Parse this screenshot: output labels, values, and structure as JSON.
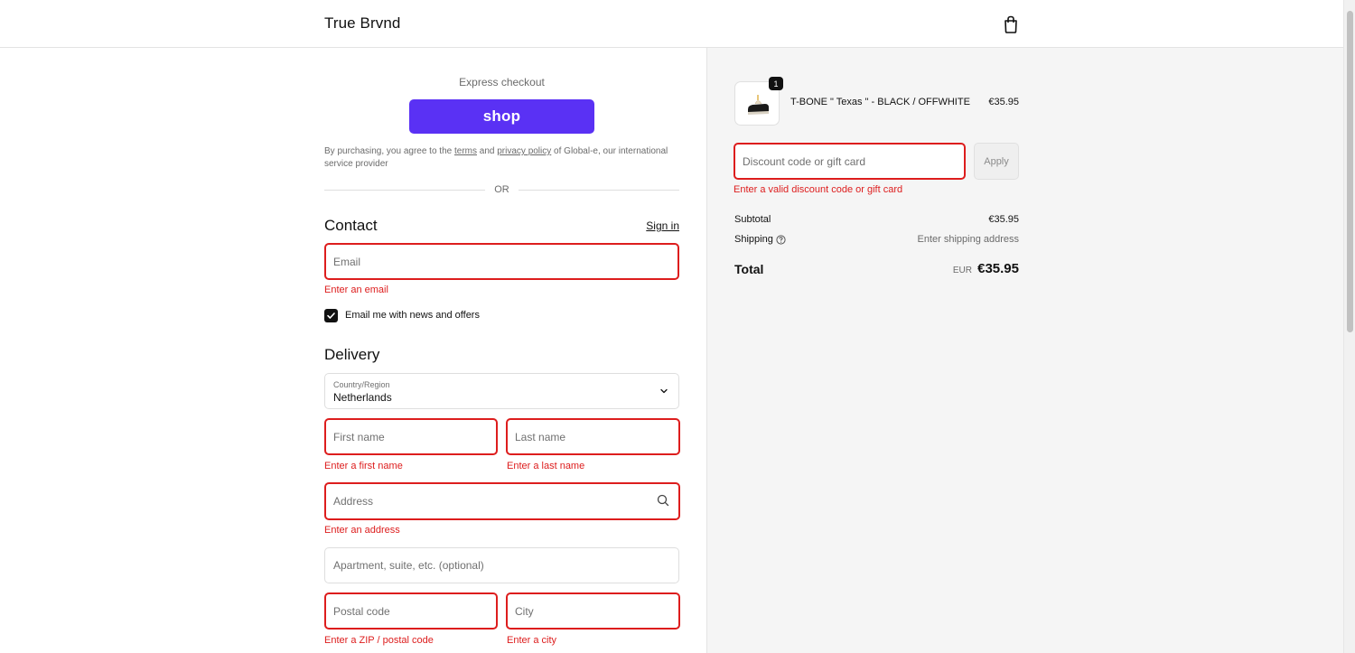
{
  "header": {
    "brand": "True Brvnd",
    "cart_icon": "shopping-bag-icon"
  },
  "express": {
    "label": "Express checkout",
    "shop_button": "shop",
    "legal_prefix": "By purchasing, you agree to the ",
    "legal_terms": "terms",
    "legal_and": " and ",
    "legal_privacy": "privacy policy",
    "legal_suffix": " of Global-e, our international service provider",
    "divider": "OR"
  },
  "contact": {
    "title": "Contact",
    "signin": "Sign in",
    "email_placeholder": "Email",
    "email_error": "Enter an email",
    "newsletter_label": "Email me with news and offers",
    "newsletter_checked": true
  },
  "delivery": {
    "title": "Delivery",
    "country_label": "Country/Region",
    "country_value": "Netherlands",
    "first_name_placeholder": "First name",
    "first_name_error": "Enter a first name",
    "last_name_placeholder": "Last name",
    "last_name_error": "Enter a last name",
    "address_placeholder": "Address",
    "address_error": "Enter an address",
    "apartment_placeholder": "Apartment, suite, etc. (optional)",
    "postal_placeholder": "Postal code",
    "postal_error": "Enter a ZIP / postal code",
    "city_placeholder": "City",
    "city_error": "Enter a city"
  },
  "summary": {
    "product": {
      "quantity": "1",
      "name": "T-BONE \" Texas \" - BLACK / OFFWHITE",
      "price": "€35.95"
    },
    "discount_placeholder": "Discount code or gift card",
    "apply_label": "Apply",
    "discount_error": "Enter a valid discount code or gift card",
    "subtotal_label": "Subtotal",
    "subtotal_value": "€35.95",
    "shipping_label": "Shipping",
    "shipping_value": "Enter shipping address",
    "total_label": "Total",
    "total_currency": "EUR",
    "total_value": "€35.95"
  },
  "colors": {
    "accent_shop": "#5a31f4",
    "error": "#dd1d1d",
    "summary_bg": "#f5f5f5"
  }
}
